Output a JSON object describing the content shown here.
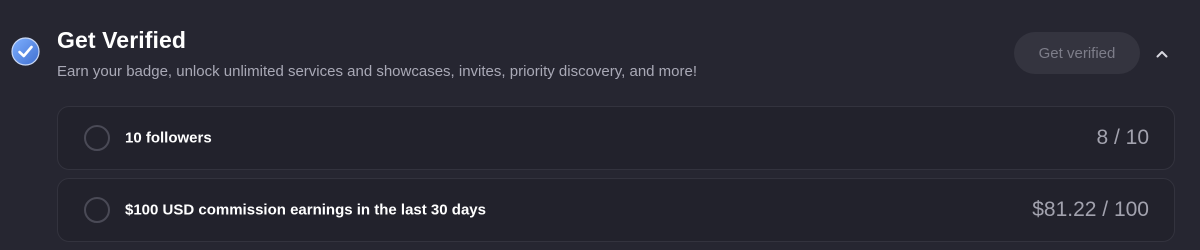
{
  "header": {
    "title": "Get Verified",
    "subtitle": "Earn your badge, unlock unlimited services and showcases, invites, priority discovery, and more!",
    "badge_icon": "verified-check-badge-icon",
    "get_verified_button_label": "Get verified",
    "collapse_icon": "chevron-up-icon"
  },
  "requirements": [
    {
      "label": "10 followers",
      "progress": "8 / 10",
      "current": 8,
      "target": 10,
      "completed": false
    },
    {
      "label": "$100 USD commission earnings in the last 30 days",
      "progress": "$81.22 / 100",
      "current": 81.22,
      "target": 100,
      "completed": false
    }
  ],
  "colors": {
    "background": "#262631",
    "card_background": "#22222c",
    "card_border": "#33333e",
    "badge_blue": "#5b8fe6",
    "muted_text": "#a9a9b6",
    "button_background": "#34343f",
    "button_text": "#7d7d89"
  }
}
